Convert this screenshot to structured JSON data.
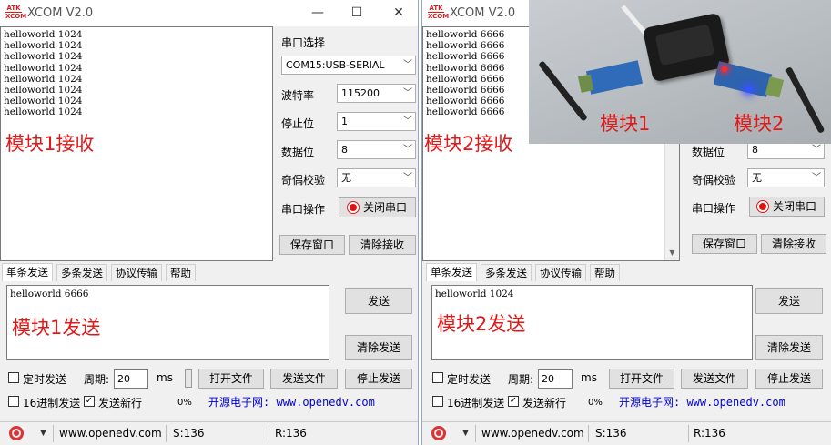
{
  "colors": {
    "overlay_red": "#e01818",
    "link_blue": "#0000d8",
    "led_red": "#e31010"
  },
  "windows": [
    {
      "title": "XCOM V2.0",
      "logo_top": "ATK",
      "logo_bottom": "XCOM",
      "controls": {
        "minimize": "—",
        "maximize": "☐",
        "close": "✕"
      },
      "receive_lines": [
        "helloworld 1024",
        "helloworld 1024",
        "helloworld 1024",
        "helloworld 1024",
        "helloworld 1024",
        "helloworld 1024",
        "helloworld 1024",
        "helloworld 1024"
      ],
      "receive_overlay": "模块1接收",
      "port_label": "串口选择",
      "port_value": "COM15:USB-SERIAL",
      "baud_label": "波特率",
      "baud_value": "115200",
      "stop_label": "停止位",
      "stop_value": "1",
      "data_label": "数据位",
      "data_value": "8",
      "parity_label": "奇偶校验",
      "parity_value": "无",
      "op_label": "串口操作",
      "close_port": "关闭串口",
      "save_window": "保存窗口",
      "clear_receive": "清除接收",
      "tabs": [
        "单条发送",
        "多条发送",
        "协议传输",
        "帮助"
      ],
      "send_text": "helloworld 6666",
      "send_overlay": "模块1发送",
      "send_btn": "发送",
      "clear_send": "清除发送",
      "timed_send": "定时发送",
      "period_label": "周期:",
      "period_value": "20",
      "period_unit": "ms",
      "open_file": "打开文件",
      "send_file": "发送文件",
      "stop_send": "停止发送",
      "hex_send": "16进制发送",
      "send_newline": "发送新行",
      "percent": "0%",
      "site_banner": "开源电子网: www.openedv.com",
      "status_url": "www.openedv.com",
      "status_s": "S:136",
      "status_r": "R:136"
    },
    {
      "title": "XCOM V2.0",
      "logo_top": "ATK",
      "logo_bottom": "XCOM",
      "receive_lines": [
        "helloworld 6666",
        "helloworld 6666",
        "helloworld 6666",
        "helloworld 6666",
        "helloworld 6666",
        "helloworld 6666",
        "helloworld 6666",
        "helloworld 6666"
      ],
      "receive_overlay": "模块2接收",
      "data_label": "数据位",
      "data_value": "8",
      "parity_label": "奇偶校验",
      "parity_value": "无",
      "op_label": "串口操作",
      "close_port": "关闭串口",
      "save_window": "保存窗口",
      "clear_receive": "清除接收",
      "tabs": [
        "单条发送",
        "多条发送",
        "协议传输",
        "帮助"
      ],
      "send_text": "helloworld 1024",
      "send_overlay": "模块2发送",
      "send_btn": "发送",
      "clear_send": "清除发送",
      "timed_send": "定时发送",
      "period_label": "周期:",
      "period_value": "20",
      "period_unit": "ms",
      "open_file": "打开文件",
      "send_file": "发送文件",
      "stop_send": "停止发送",
      "hex_send": "16进制发送",
      "send_newline": "发送新行",
      "percent": "0%",
      "site_banner": "开源电子网: www.openedv.com",
      "status_url": "www.openedv.com",
      "status_s": "S:136",
      "status_r": "R:136"
    }
  ],
  "photo": {
    "label_left": "模块1",
    "label_right": "模块2"
  },
  "icons": {
    "checked": "✓",
    "dropdown": "﹀",
    "scroll_up": "▲",
    "scroll_down": "▼",
    "caret": "▼"
  }
}
